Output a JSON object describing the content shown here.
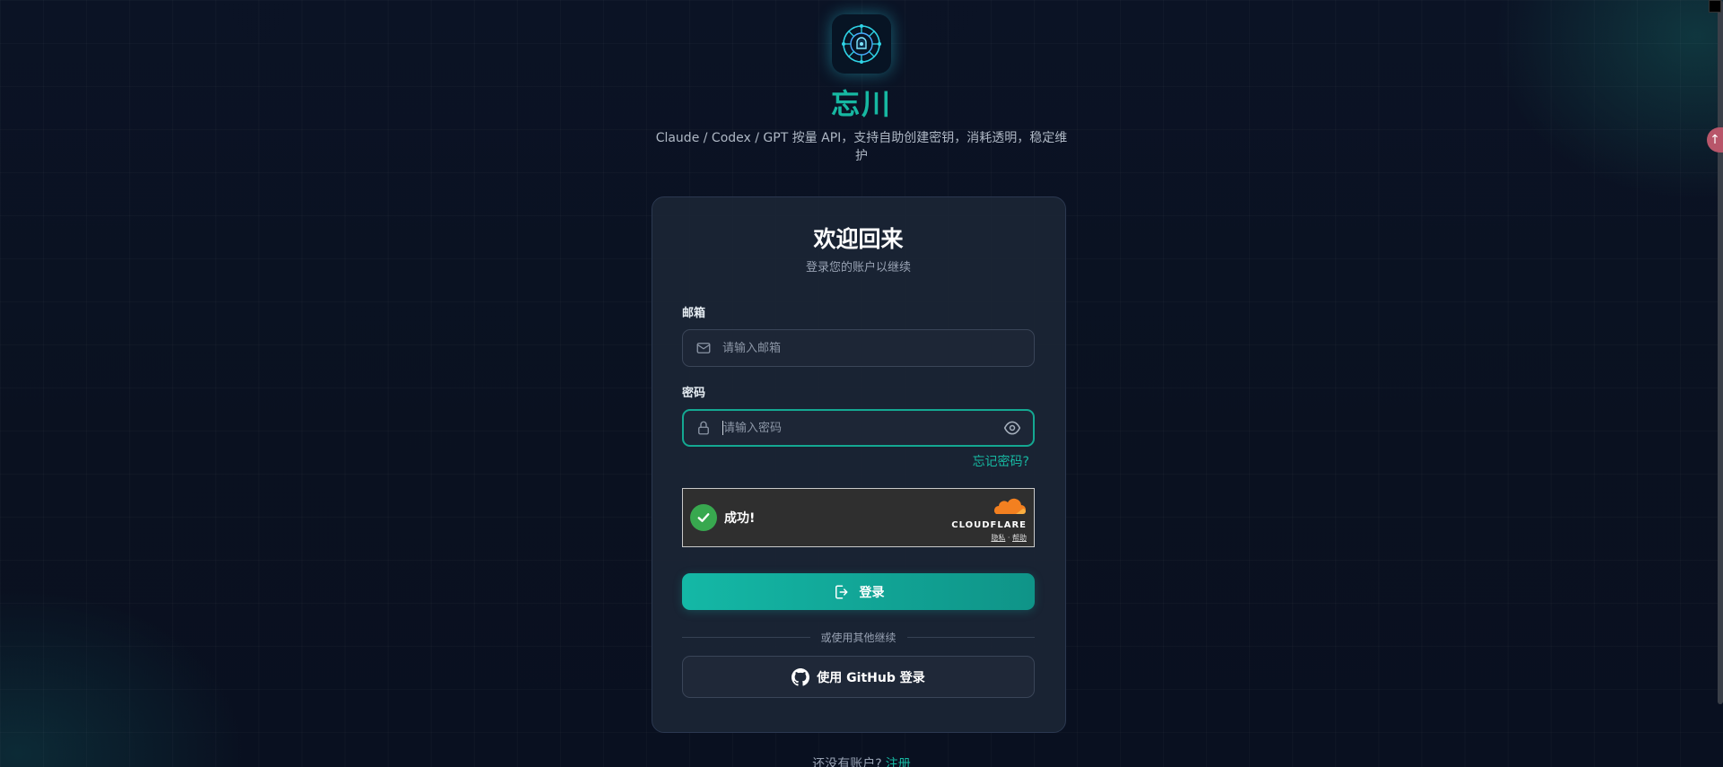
{
  "brand": {
    "name": "忘川",
    "tagline": "Claude / Codex / GPT 按量 API，支持自助创建密钥，消耗透明，稳定维护"
  },
  "login": {
    "title": "欢迎回来",
    "subtitle": "登录您的账户以继续",
    "email_label": "邮箱",
    "email_placeholder": "请输入邮箱",
    "password_label": "密码",
    "password_placeholder": "请输入密码",
    "forgot_link": "忘记密码?",
    "captcha_status": "成功!",
    "captcha_brand": "CLOUDFLARE",
    "captcha_privacy": "隐私",
    "captcha_help": "帮助",
    "login_button": "登录",
    "divider_text": "或使用其他继续",
    "github_button": "使用 GitHub 登录"
  },
  "footer": {
    "prompt": "还没有账户?",
    "register_link": "注册"
  },
  "colors": {
    "accent": "#17b8a2",
    "background": "#0b1325",
    "card": "#1b2536",
    "success": "#38a84f"
  }
}
